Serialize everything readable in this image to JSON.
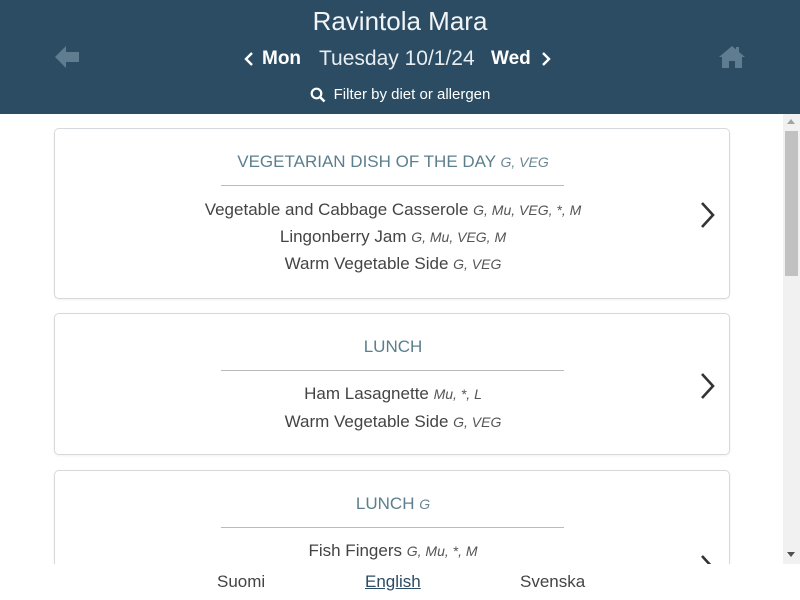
{
  "header": {
    "title": "Ravintola Mara",
    "prev_day": "Mon",
    "current_date": "Tuesday 10/1/24",
    "next_day": "Wed",
    "filter_label": "Filter by diet or allergen"
  },
  "menu": [
    {
      "category": "VEGETARIAN DISH OF THE DAY",
      "category_tags": "G, VEG",
      "dishes": [
        {
          "name": "Vegetable and Cabbage Casserole",
          "tags": "G, Mu, VEG, *, M"
        },
        {
          "name": "Lingonberry Jam",
          "tags": "G, Mu, VEG, M"
        },
        {
          "name": "Warm Vegetable Side",
          "tags": "G, VEG"
        }
      ]
    },
    {
      "category": "LUNCH",
      "category_tags": "",
      "dishes": [
        {
          "name": "Ham Lasagnette",
          "tags": "Mu, *, L"
        },
        {
          "name": "Warm Vegetable Side",
          "tags": "G, VEG"
        }
      ]
    },
    {
      "category": "LUNCH",
      "category_tags": "G",
      "dishes": [
        {
          "name": "Fish Fingers",
          "tags": "G, Mu, *, M"
        }
      ]
    }
  ],
  "footer": {
    "languages": [
      "Suomi",
      "English",
      "Svenska"
    ],
    "active_language": "English"
  },
  "colors": {
    "header_bg": "#2b4c63",
    "category_text": "#5b7f8e"
  }
}
